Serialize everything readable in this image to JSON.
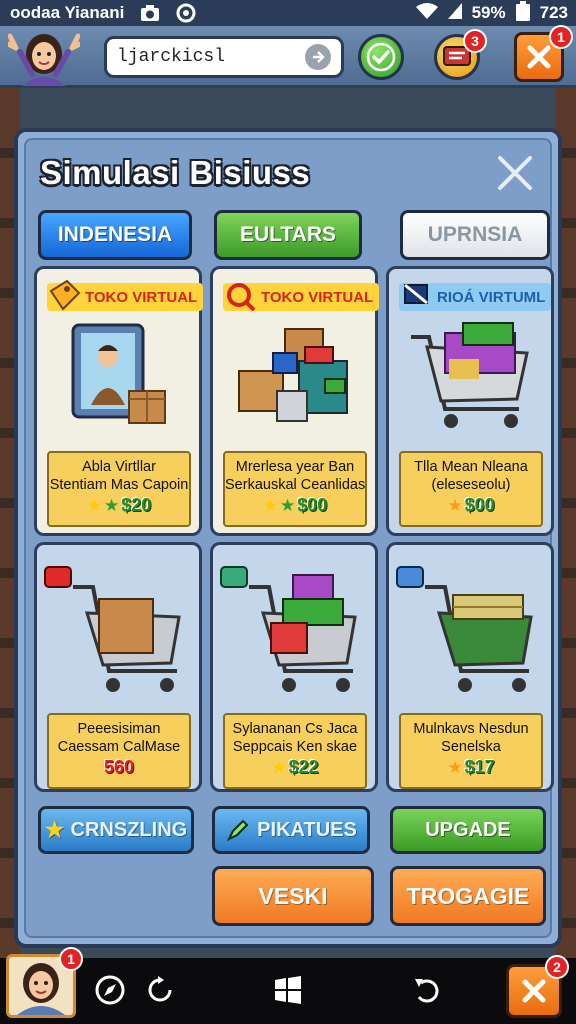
{
  "status_bar": {
    "title": "oodaa Yianani",
    "battery_percent": "59%",
    "time": "723"
  },
  "top_bar": {
    "search_value": "ljarckicsl",
    "message_badge": "3",
    "close_badge": "1"
  },
  "dialog": {
    "title": "Simulasi Bisiuss",
    "tabs": [
      {
        "label": "INDENESIA"
      },
      {
        "label": "EULTARS"
      },
      {
        "label": "UPRNSIA"
      }
    ],
    "cards": [
      {
        "tag": "TOKO VIRTUAL",
        "line1": "Abla Virtllar",
        "line2": "Stentiam Mas Capoin",
        "price": "$20",
        "stars": "★★"
      },
      {
        "tag": "TOKO VIRTUAL",
        "line1": "Mrerlesa year Ban",
        "line2": "Serkauskal Ceanlidas",
        "price": "$00",
        "stars": "★★"
      },
      {
        "tag": "RIOÁ VIRTUML",
        "line1": "Tlla Mean Nleana",
        "line2": "(eleseseolu)",
        "price": "$00",
        "stars": "★"
      },
      {
        "tag": "",
        "line1": "Peeesisiman",
        "line2": "Caessam CalMase",
        "price": "560",
        "stars": ""
      },
      {
        "tag": "",
        "line1": "Sylananan Cs Jaca",
        "line2": "Seppcais Ken skae",
        "price": "$22",
        "stars": "★"
      },
      {
        "tag": "",
        "line1": "Mulnkavs Nesdun",
        "line2": "Senelska",
        "price": "$17",
        "stars": "★"
      }
    ],
    "buttons": {
      "crnszling": "CRNSZLING",
      "pikatues": "PIKATUES",
      "upgade": "UPGADE",
      "veski": "VESKI",
      "trogagie": "TROGAGIE"
    }
  },
  "nav_bar": {
    "avatar_badge": "1",
    "close_badge": "2"
  },
  "colors": {
    "tab_blue": "#1467d6",
    "tab_green": "#3e9a2a",
    "accent_orange": "#ef7a22",
    "panel_yellow": "#f6cf5c"
  }
}
